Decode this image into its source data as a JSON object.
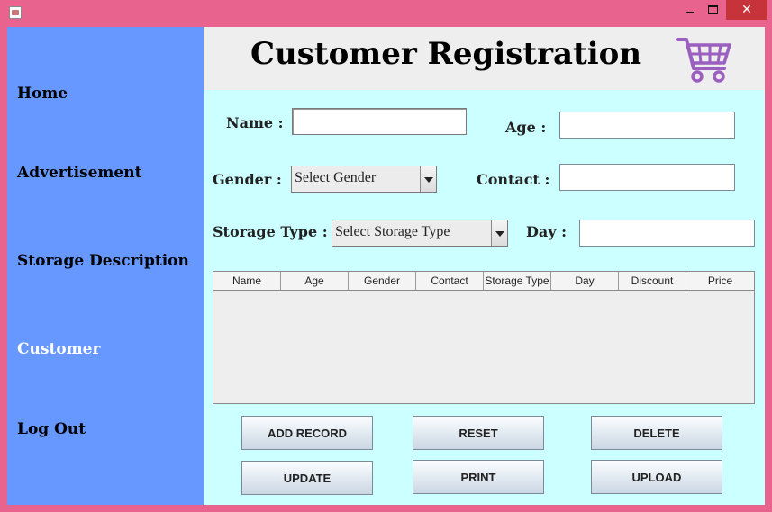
{
  "window": {
    "minimize_glyph": "",
    "maximize_glyph": "",
    "close_glyph": "✕"
  },
  "sidebar": {
    "items": [
      {
        "label": "Home"
      },
      {
        "label": "Advertisement"
      },
      {
        "label": "Storage Description"
      },
      {
        "label": "Customer",
        "active": true
      },
      {
        "label": "Log Out"
      }
    ]
  },
  "header": {
    "title": "Customer Registration",
    "icon": "shopping-cart-icon"
  },
  "form": {
    "name_label": "Name :",
    "name_value": "",
    "age_label": "Age :",
    "age_value": "",
    "gender_label": "Gender :",
    "gender_selected": "Select Gender",
    "contact_label": "Contact :",
    "contact_value": "",
    "storage_type_label": "Storage Type :",
    "storage_type_selected": "Select Storage Type",
    "day_label": "Day :",
    "day_value": ""
  },
  "table": {
    "columns": [
      "Name",
      "Age",
      "Gender",
      "Contact",
      "Storage Type",
      "Day",
      "Discount",
      "Price"
    ],
    "rows": []
  },
  "buttons": {
    "add_record": "ADD RECORD",
    "reset": "RESET",
    "delete": "DELETE",
    "update": "UPDATE",
    "print": "PRINT",
    "upload": "UPLOAD"
  },
  "colors": {
    "window_frame": "#e8648e",
    "sidebar": "#6698ff",
    "content": "#ccffff",
    "header": "#eeeeee",
    "cart_icon": "#9b5fc0"
  }
}
